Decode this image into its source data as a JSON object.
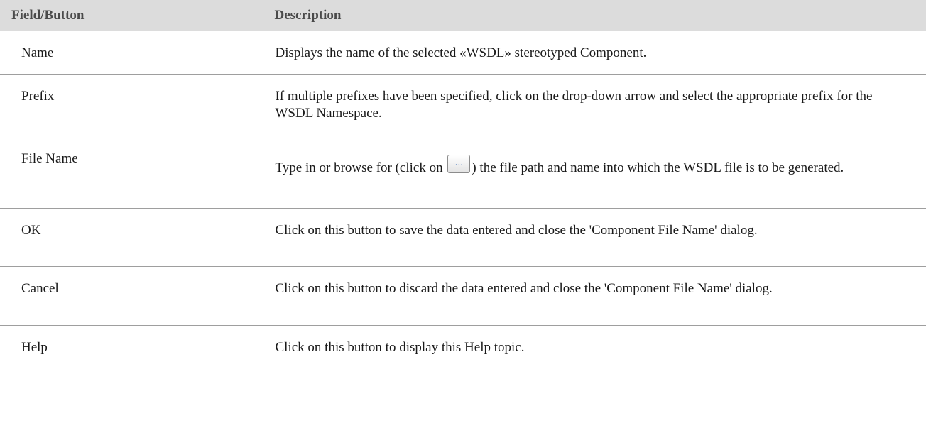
{
  "table": {
    "headers": [
      "Field/Button",
      "Description"
    ],
    "rows": [
      {
        "field": "Name",
        "description": "Displays the name of the selected «WSDL» stereotyped Component."
      },
      {
        "field": "Prefix",
        "description": "If multiple prefixes have been specified, click on the drop-down arrow and select the appropriate prefix for the WSDL Namespace."
      },
      {
        "field": "File Name",
        "description_before": "Type in or browse for (click on ",
        "button_icon": "browse-ellipsis-button",
        "button_glyph": "...",
        "description_after": ") the file path and name into which the WSDL file is to be generated."
      },
      {
        "field": "OK",
        "description": "Click on this button to save the data entered and close the 'Component File Name' dialog."
      },
      {
        "field": "Cancel",
        "description": "Click on this button to discard the data entered and close the 'Component File Name' dialog."
      },
      {
        "field": "Help",
        "description": "Click on this button to display this Help topic."
      }
    ]
  },
  "colors": {
    "header_background": "#dcdcdc",
    "header_text": "#4a4a4a",
    "border": "#9e9e9e",
    "button_dots": "#3d6fb5"
  }
}
